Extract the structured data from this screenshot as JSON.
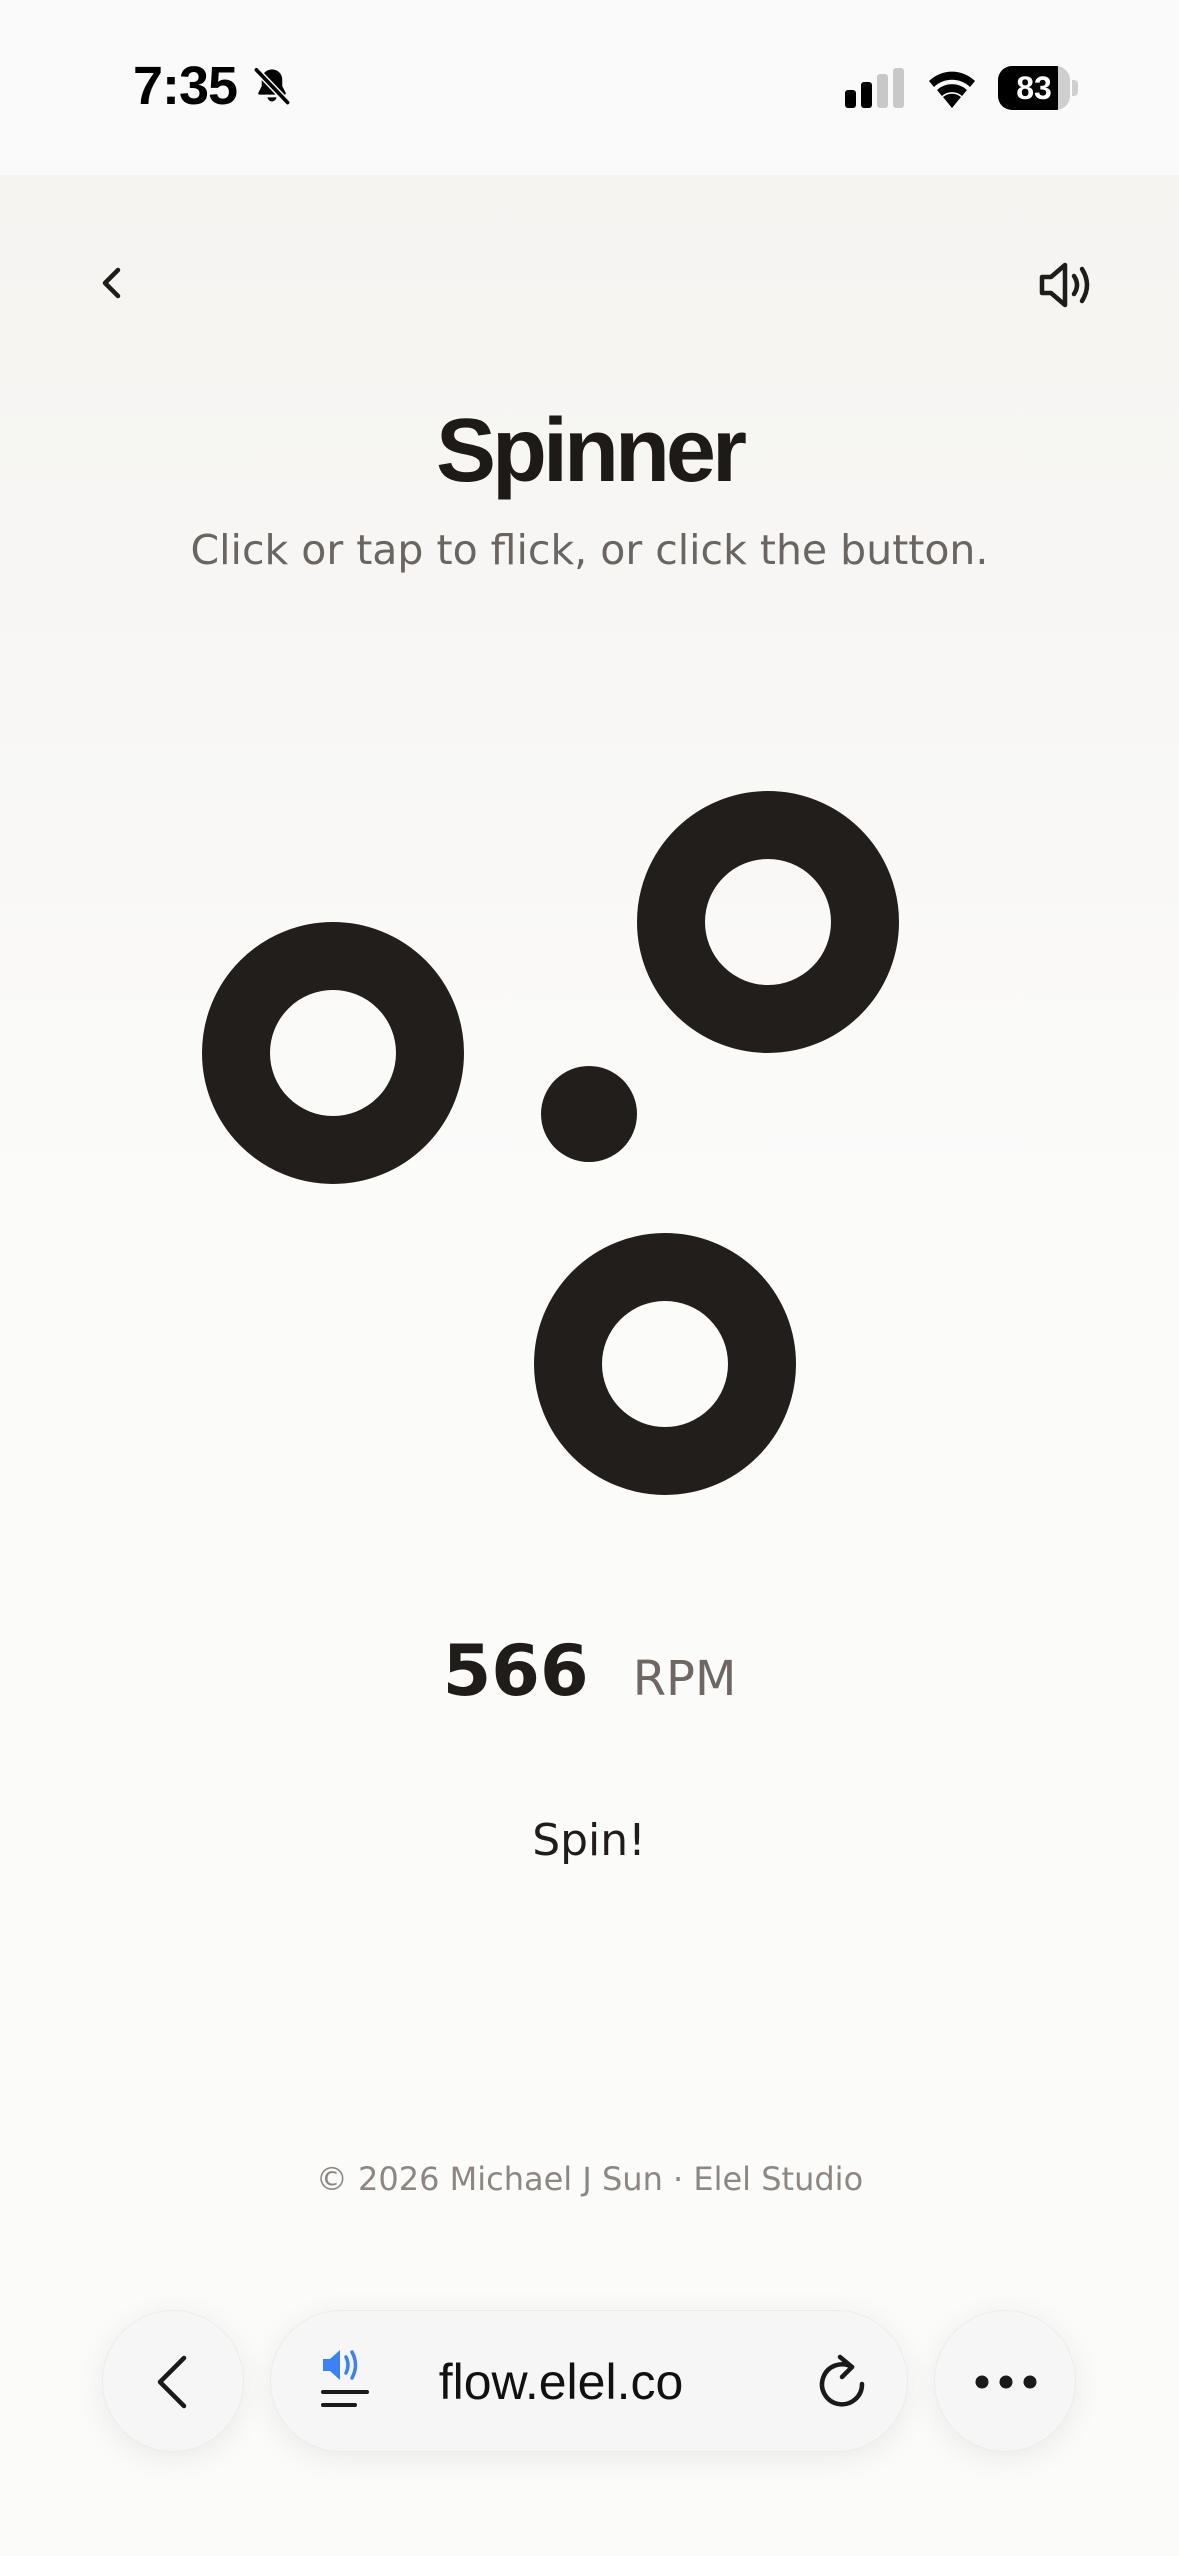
{
  "status_bar": {
    "time": "7:35",
    "battery_percent": "83",
    "battery_level": 0.83,
    "icons": [
      "bell-slash-icon",
      "cellular-signal-icon",
      "wifi-icon",
      "battery-icon"
    ]
  },
  "header": {
    "back_icon": "chevron-left-icon",
    "sound_icon": "speaker-on-icon",
    "title": "Spinner",
    "subtitle": "Click or tap to flick, or click the button."
  },
  "spinner": {
    "color": "#221e1b"
  },
  "readout": {
    "value": "566",
    "unit": "RPM"
  },
  "spin_button": {
    "label": "Spin!"
  },
  "footer": {
    "text": "© 2026 Michael J Sun · Elel Studio"
  },
  "browser": {
    "url": "flow.elel.co",
    "audio_icon_color": "#3b82f6",
    "icons": [
      "browser-back-icon",
      "audio-playing-menu-icon",
      "reload-icon",
      "more-icon"
    ]
  }
}
